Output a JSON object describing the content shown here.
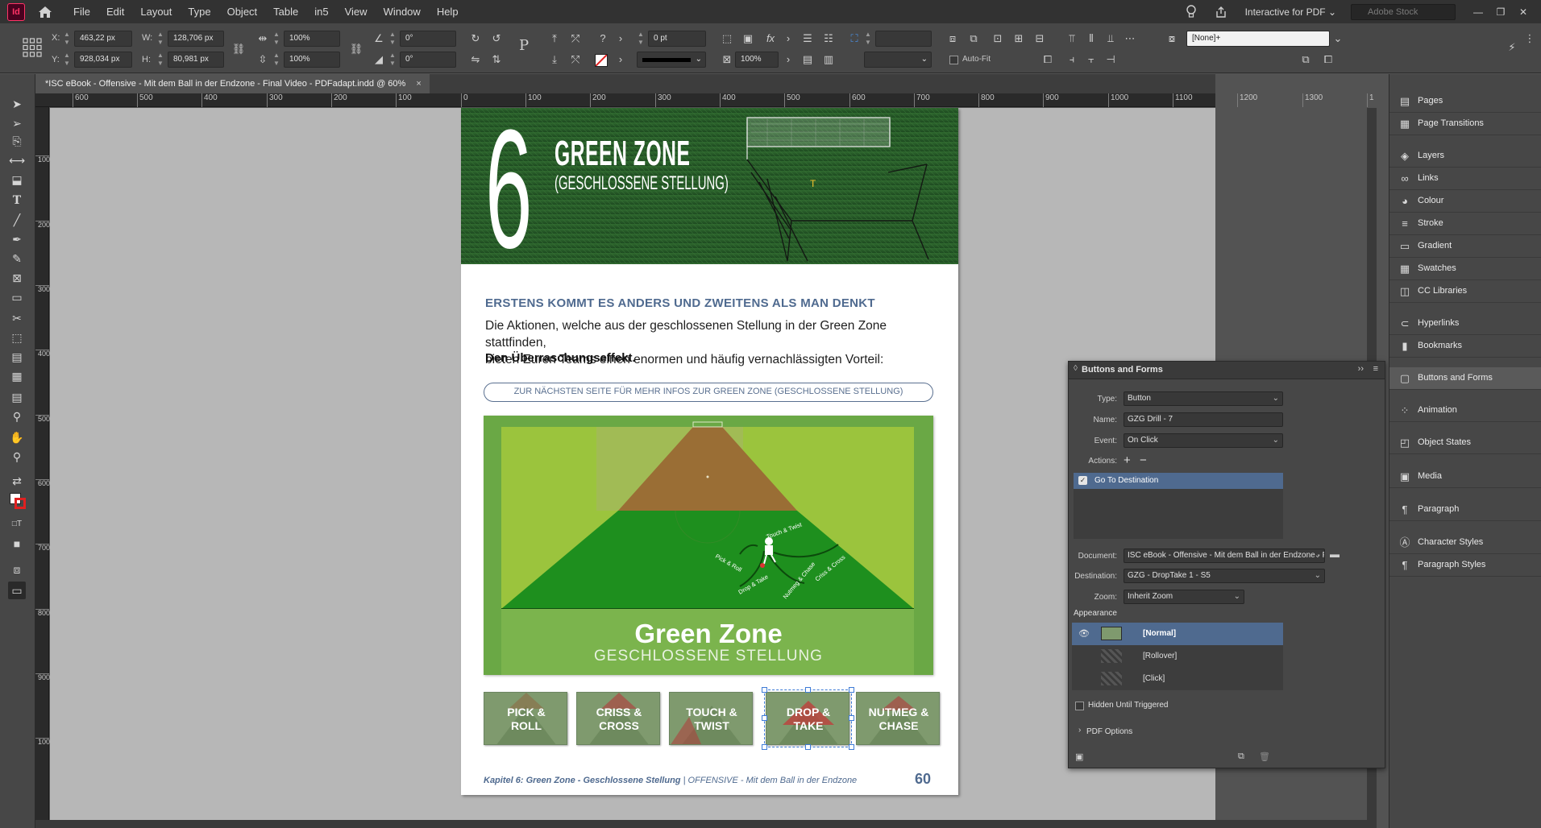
{
  "app": {
    "logo_text": "Id",
    "menu": [
      "File",
      "Edit",
      "Layout",
      "Type",
      "Object",
      "Table",
      "in5",
      "View",
      "Window",
      "Help"
    ],
    "workspace": "Interactive for PDF",
    "stock_search_placeholder": "Adobe Stock"
  },
  "control": {
    "x_label": "X:",
    "x_value": "463,22 px",
    "y_label": "Y:",
    "y_value": "928,034 px",
    "w_label": "W:",
    "w_value": "128,706 px",
    "h_label": "H:",
    "h_value": "80,981 px",
    "scale_x": "100%",
    "scale_y": "100%",
    "rotate": "0°",
    "shear": "0°",
    "stroke_weight": "0 pt",
    "opacity": "100%",
    "autofit_label": "Auto-Fit",
    "object_style": "[None]+"
  },
  "document_tab": {
    "title": "*ISC eBook - Offensive - Mit dem Ball in der Endzone - Final Video - PDFadapt.indd @ 60%",
    "close": "×"
  },
  "ruler": {
    "top_ticks": [
      "600",
      "500",
      "400",
      "300",
      "200",
      "100",
      "0",
      "100",
      "200",
      "300",
      "400",
      "500",
      "600",
      "700",
      "800",
      "900",
      "1000",
      "1100",
      "1200",
      "1300",
      "1"
    ],
    "left_ticks": [
      "100",
      "200",
      "300",
      "400",
      "500",
      "600",
      "700",
      "800",
      "900",
      "1000"
    ]
  },
  "page": {
    "chapter_number": "6",
    "hero_title": "GREEN ZONE",
    "hero_subtitle": "(GESCHLOSSENE STELLUNG)",
    "section_heading": "ERSTENS KOMMT ES ANDERS UND ZWEITENS ALS MAN DENKT",
    "body_line1": "Die Aktionen, welche aus der geschlossenen Stellung in der Green Zone stattfinden,",
    "body_line2": "bieten Euren Teams einen enormen und häufig vernachlässigten Vorteil:",
    "body_bold": "Den Überraschungseffekt.",
    "next_link": "ZUR NÄCHSTEN SEITE FÜR MEHR INFOS ZUR GREEN ZONE (GESCHLOSSENE STELLUNG)",
    "zone_title": "Green Zone",
    "zone_subtitle": "GESCHLOSSENE STELLUNG",
    "field_labels": {
      "touch_twist": "Touch & Twist",
      "pick_roll": "Pick & Roll",
      "criss_cross": "Criss & Cross",
      "drop_take": "Drop & Take",
      "nutmeg_chase": "Nutmeg & Chase"
    },
    "drill_buttons": [
      {
        "line1": "PICK &",
        "line2": "ROLL"
      },
      {
        "line1": "CRISS &",
        "line2": "CROSS"
      },
      {
        "line1": "TOUCH &",
        "line2": "TWIST"
      },
      {
        "line1": "DROP &",
        "line2": "TAKE"
      },
      {
        "line1": "NUTMEG &",
        "line2": "CHASE"
      }
    ],
    "footer_chapter": "Kapitel 6: Green Zone - Geschlossene Stellung",
    "footer_book": " | OFFENSIVE - Mit dem Ball in der Endzone",
    "page_number": "60"
  },
  "buttons_forms": {
    "title": "Buttons and Forms",
    "type_label": "Type:",
    "type_value": "Button",
    "name_label": "Name:",
    "name_value": "GZG Drill - 7",
    "event_label": "Event:",
    "event_value": "On Click",
    "actions_label": "Actions:",
    "action_item": "Go To Destination",
    "document_label": "Document:",
    "document_value": "ISC eBook - Offensive - Mit dem Ball in der Endzone - Final...",
    "destination_label": "Destination:",
    "destination_value": "GZG - DropTake 1 - S5",
    "zoom_label": "Zoom:",
    "zoom_value": "Inherit Zoom",
    "appearance_label": "Appearance",
    "states": [
      "[Normal]",
      "[Rollover]",
      "[Click]"
    ],
    "hidden_label": "Hidden Until Triggered",
    "pdf_options": "PDF Options"
  },
  "dock": [
    {
      "icon": "pages-icon",
      "glyph": "▤",
      "label": "Pages"
    },
    {
      "icon": "page-transitions-icon",
      "glyph": "▦",
      "label": "Page Transitions"
    },
    {
      "icon": "layers-icon",
      "glyph": "◈",
      "label": "Layers"
    },
    {
      "icon": "links-icon",
      "glyph": "∞",
      "label": "Links"
    },
    {
      "icon": "colour-icon",
      "glyph": "◕",
      "label": "Colour"
    },
    {
      "icon": "stroke-icon",
      "glyph": "≡",
      "label": "Stroke"
    },
    {
      "icon": "gradient-icon",
      "glyph": "▭",
      "label": "Gradient"
    },
    {
      "icon": "swatches-icon",
      "glyph": "▦",
      "label": "Swatches"
    },
    {
      "icon": "cc-libraries-icon",
      "glyph": "◫",
      "label": "CC Libraries"
    },
    {
      "icon": "hyperlinks-icon",
      "glyph": "⊂",
      "label": "Hyperlinks"
    },
    {
      "icon": "bookmarks-icon",
      "glyph": "▮",
      "label": "Bookmarks"
    },
    {
      "icon": "buttons-forms-icon",
      "glyph": "▢",
      "label": "Buttons and Forms"
    },
    {
      "icon": "animation-icon",
      "glyph": "⁘",
      "label": "Animation"
    },
    {
      "icon": "object-states-icon",
      "glyph": "◰",
      "label": "Object States"
    },
    {
      "icon": "media-icon",
      "glyph": "▣",
      "label": "Media"
    },
    {
      "icon": "paragraph-icon",
      "glyph": "¶",
      "label": "Paragraph"
    },
    {
      "icon": "character-styles-icon",
      "glyph": "Ⓐ",
      "label": "Character Styles"
    },
    {
      "icon": "paragraph-styles-icon",
      "glyph": "¶",
      "label": "Paragraph Styles"
    }
  ],
  "colors": {
    "accent_blue": "#4f6a8f",
    "selection_blue": "#3e7bd6",
    "field_green": "#1e8f1e",
    "zone_brown": "#9a6e35"
  }
}
